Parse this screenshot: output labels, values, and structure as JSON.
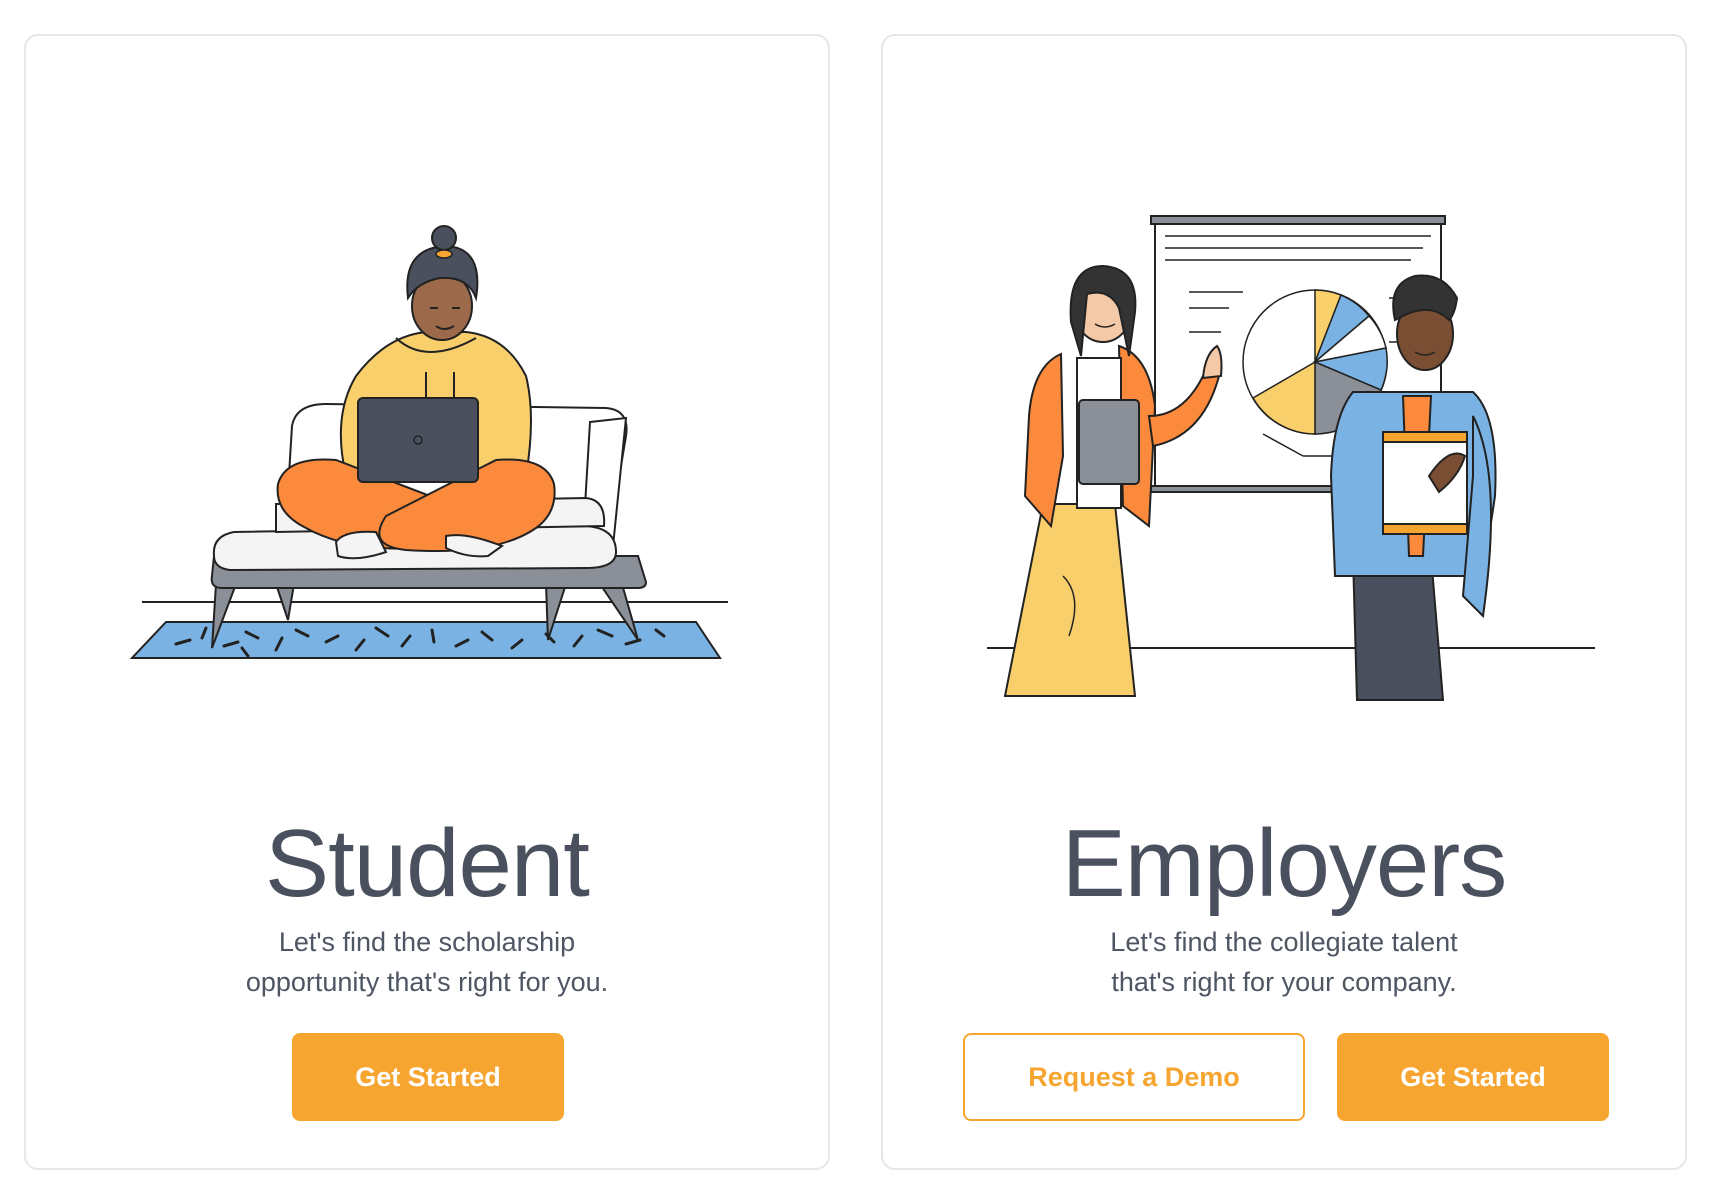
{
  "colors": {
    "accent": "#f6a531",
    "heading": "#4a505e",
    "body_text": "#4e5563",
    "card_border": "#e6e7ea"
  },
  "student": {
    "title": "Student",
    "description_line1": "Let's find the scholarship",
    "description_line2": "opportunity that's right for you.",
    "get_started_label": "Get Started",
    "illustration_icon": "student-on-couch-with-laptop-illustration"
  },
  "employer": {
    "title": "Employers",
    "description_line1": "Let's find the collegiate talent",
    "description_line2": "that's right for your company.",
    "request_demo_label": "Request a Demo",
    "get_started_label": "Get Started",
    "illustration_icon": "two-people-presenting-pie-chart-illustration"
  }
}
